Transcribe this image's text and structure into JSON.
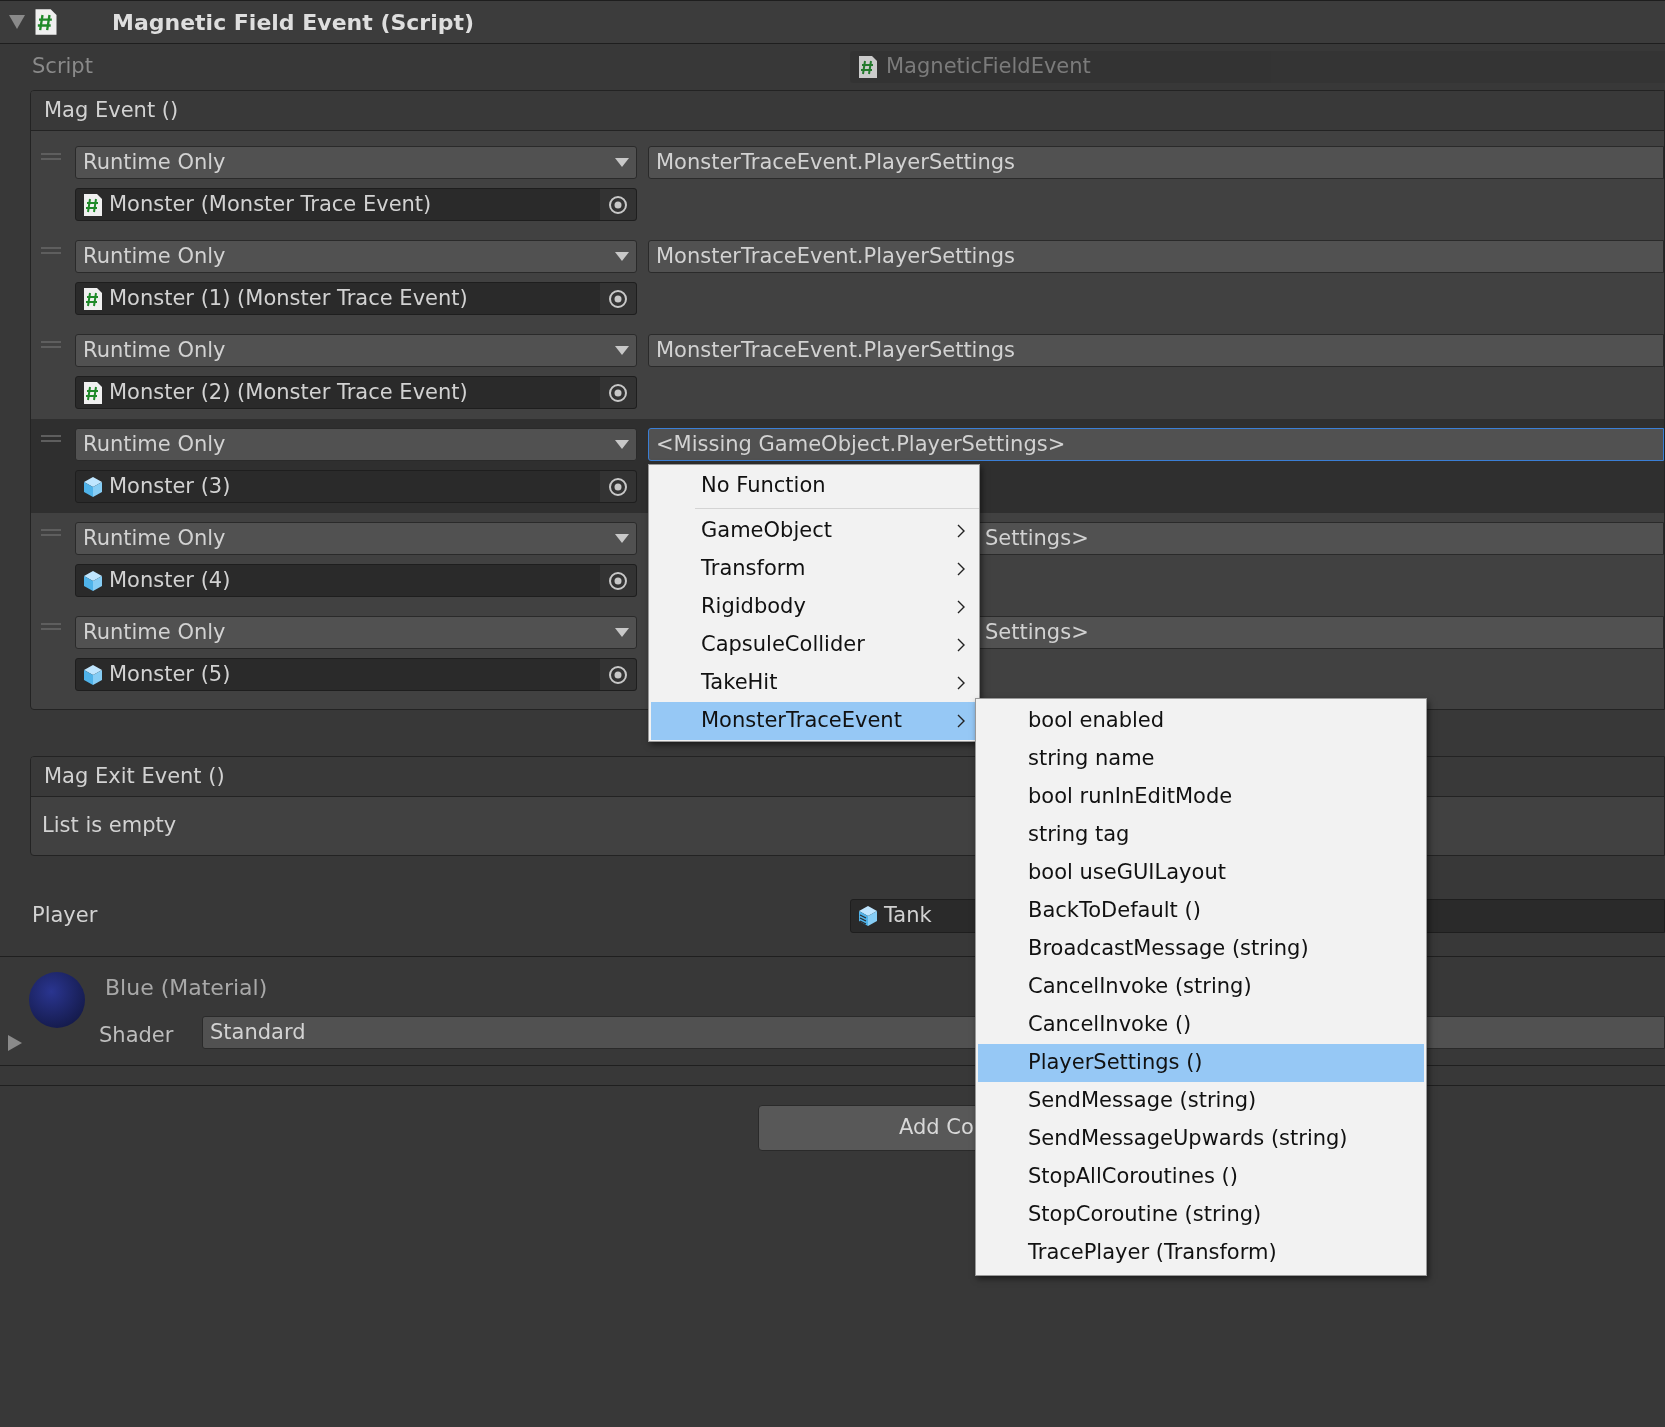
{
  "component": {
    "title": "Magnetic Field Event (Script)",
    "expanded": true
  },
  "script_field": {
    "label": "Script",
    "value": "MagneticFieldEvent"
  },
  "mag_event": {
    "header": "Mag Event ()",
    "entries": [
      {
        "mode": "Runtime Only",
        "target": "Monster (Monster Trace Event)",
        "kind": "script",
        "function": "MonsterTraceEvent.PlayerSettings",
        "selected": false,
        "covered": false
      },
      {
        "mode": "Runtime Only",
        "target": "Monster (1) (Monster Trace Event)",
        "kind": "script",
        "function": "MonsterTraceEvent.PlayerSettings",
        "selected": false,
        "covered": false
      },
      {
        "mode": "Runtime Only",
        "target": "Monster (2) (Monster Trace Event)",
        "kind": "script",
        "function": "MonsterTraceEvent.PlayerSettings",
        "selected": false,
        "covered": false
      },
      {
        "mode": "Runtime Only",
        "target": "Monster (3)",
        "kind": "gameobject",
        "function": "<Missing GameObject.PlayerSettings>",
        "selected": true,
        "covered": false
      },
      {
        "mode": "Runtime Only",
        "target": "Monster (4)",
        "kind": "gameobject",
        "function": "Settings>",
        "selected": false,
        "covered": true
      },
      {
        "mode": "Runtime Only",
        "target": "Monster (5)",
        "kind": "gameobject",
        "function": "Settings>",
        "selected": false,
        "covered": true
      }
    ]
  },
  "mag_exit_event": {
    "header": "Mag Exit Event ()",
    "empty_text": "List is empty"
  },
  "player_field": {
    "label": "Player",
    "value": "Tank"
  },
  "material": {
    "name": "Blue (Material)",
    "shader_label": "Shader",
    "shader": "Standard",
    "expanded": false
  },
  "add_button": {
    "label": "Add Co"
  },
  "function_menu": {
    "items": [
      {
        "label": "No Function",
        "has_submenu": false,
        "selected": false
      },
      {
        "label": "GameObject",
        "has_submenu": true,
        "selected": false
      },
      {
        "label": "Transform",
        "has_submenu": true,
        "selected": false
      },
      {
        "label": "Rigidbody",
        "has_submenu": true,
        "selected": false
      },
      {
        "label": "CapsuleCollider",
        "has_submenu": true,
        "selected": false
      },
      {
        "label": "TakeHit",
        "has_submenu": true,
        "selected": false
      },
      {
        "label": "MonsterTraceEvent",
        "has_submenu": true,
        "selected": true
      }
    ]
  },
  "submenu": {
    "items": [
      {
        "label": "bool enabled",
        "selected": false
      },
      {
        "label": "string name",
        "selected": false
      },
      {
        "label": "bool runInEditMode",
        "selected": false
      },
      {
        "label": "string tag",
        "selected": false
      },
      {
        "label": "bool useGUILayout",
        "selected": false
      },
      {
        "label": "BackToDefault ()",
        "selected": false
      },
      {
        "label": "BroadcastMessage (string)",
        "selected": false
      },
      {
        "label": "CancelInvoke (string)",
        "selected": false
      },
      {
        "label": "CancelInvoke ()",
        "selected": false
      },
      {
        "label": "PlayerSettings ()",
        "selected": true
      },
      {
        "label": "SendMessage (string)",
        "selected": false
      },
      {
        "label": "SendMessageUpwards (string)",
        "selected": false
      },
      {
        "label": "StopAllCoroutines ()",
        "selected": false
      },
      {
        "label": "StopCoroutine (string)",
        "selected": false
      },
      {
        "label": "TracePlayer (Transform)",
        "selected": false
      }
    ]
  }
}
